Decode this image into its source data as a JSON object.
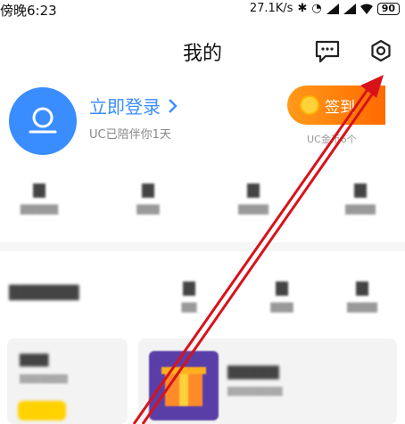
{
  "status_bar": {
    "time": "傍晚6:23",
    "net_speed": "27.1K/s",
    "battery": "90"
  },
  "header": {
    "title": "我的",
    "message_icon": "chat-bubble-icon",
    "settings_icon": "gear-icon"
  },
  "profile": {
    "login_label": "立即登录",
    "subtitle": "UC已陪伴你1天"
  },
  "checkin": {
    "label": "签到",
    "subtitle": "UC金币6个"
  },
  "colors": {
    "accent_blue": "#3a8dff",
    "accent_orange": "#ff7a10",
    "annotation_red": "#d8121a"
  }
}
